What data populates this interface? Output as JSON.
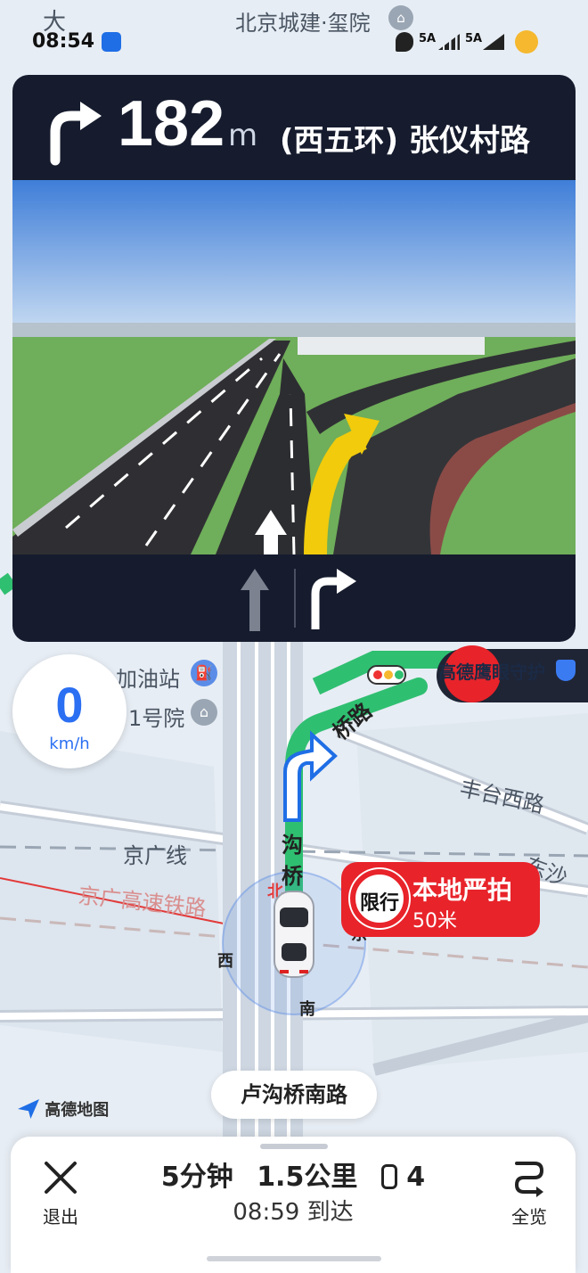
{
  "status_bar": {
    "time": "08:54",
    "signal1": "5A",
    "signal2": "5A"
  },
  "map_labels": {
    "top": "北京城建·玺院",
    "corner": "大",
    "gas": "加油站",
    "yard": "1号院",
    "road_upper": "桥路",
    "fengtai": "丰台西路",
    "jingguang": "京广线",
    "jingguang_rail": "京广高速铁路",
    "gouqiao": "沟桥",
    "bei": "北",
    "east": "东",
    "west": "西",
    "south": "南",
    "dongsha": "东沙"
  },
  "guidance": {
    "distance": "182",
    "unit": "m",
    "road": "(西五环) 张仪村路",
    "turn_icon": "turn-right-arrow-icon"
  },
  "speed": {
    "value": "0",
    "unit": "km/h"
  },
  "camera": {
    "label": "高德鹰眼守护"
  },
  "restriction": {
    "badge": "限行",
    "title": "本地严拍",
    "distance": "50米"
  },
  "current_street": "卢沟桥南路",
  "logo": "高德地图",
  "trip": {
    "duration": "5分钟",
    "distance": "1.5公里",
    "lights": "4",
    "arrival": "08:59 到达",
    "exit_label": "退出",
    "overview_label": "全览"
  },
  "colors": {
    "accent_blue": "#2b6ff2",
    "alert_red": "#e8232a",
    "panel_dark": "#161c2e",
    "route_green": "#2fbf71"
  }
}
